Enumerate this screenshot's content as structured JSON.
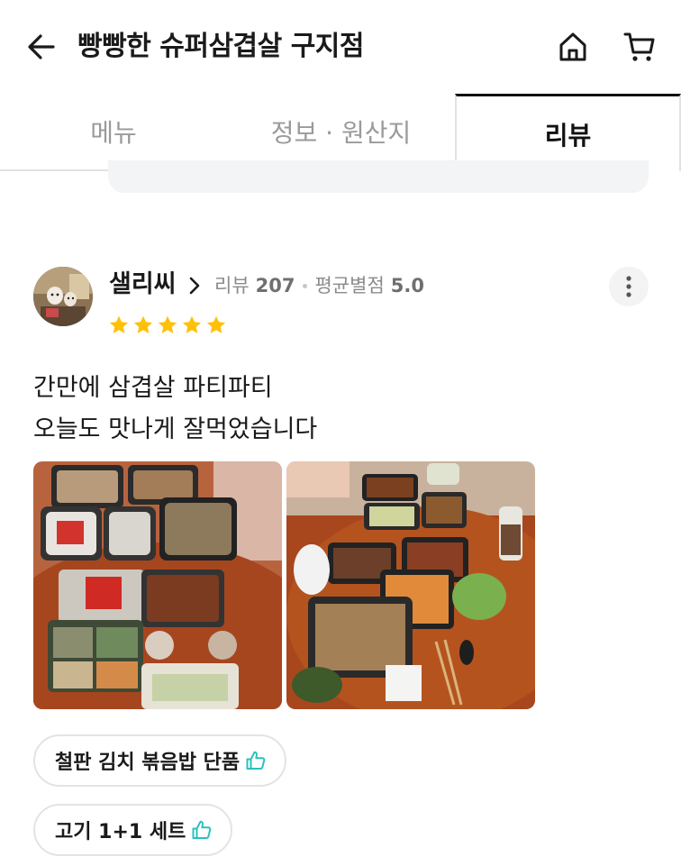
{
  "header": {
    "title": "빵빵한 슈퍼삼겹살 구지점",
    "back_icon": "arrow-left-icon",
    "home_icon": "home-icon",
    "cart_icon": "cart-icon"
  },
  "tabs": [
    {
      "label": "메뉴",
      "active": false
    },
    {
      "label": "정보 · 원산지",
      "active": false
    },
    {
      "label": "리뷰",
      "active": true
    }
  ],
  "review": {
    "nickname": "샐리씨",
    "review_count_label": "리뷰",
    "review_count": "207",
    "avg_rating_label": "평균별점",
    "avg_rating": "5.0",
    "rating": 5,
    "text_lines": [
      "간만에 삼겹살 파티파티",
      "오늘도 맛나게 잘먹었습니다"
    ],
    "menu_tags": [
      {
        "label": "철판 김치 볶음밥 단품",
        "icon": "thumbs-up-icon"
      },
      {
        "label": "고기 1+1 세트",
        "icon": "thumbs-up-icon"
      }
    ]
  },
  "colors": {
    "star": "#FFC107",
    "accent": "#2AC1BC",
    "active_tab_border": "#111111"
  }
}
